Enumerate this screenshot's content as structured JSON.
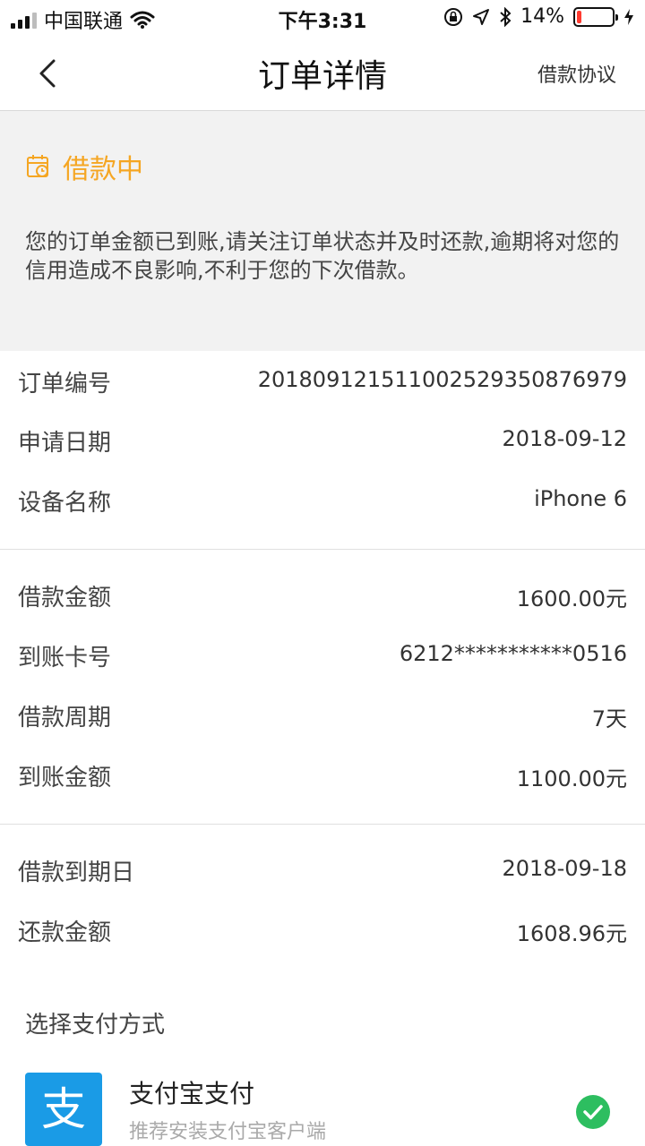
{
  "statusbar": {
    "carrier": "中国联通",
    "time": "下午3:31",
    "battery_text": "14%",
    "battery_level": 0.14,
    "icons": [
      "signal-icon",
      "wifi-icon",
      "rotation-lock-icon",
      "location-icon",
      "bluetooth-icon",
      "battery-icon",
      "charging-icon"
    ]
  },
  "nav": {
    "title": "订单详情",
    "agreement": "借款协议",
    "back_icon": "chevron-left-icon"
  },
  "status": {
    "label": "借款中",
    "message": "您的订单金额已到账,请关注订单状态并及时还款,逾期将对您的信用造成不良影响,不利于您的下次借款。",
    "color": "#f5a623",
    "icon": "clock-calendar-icon"
  },
  "section1": [
    {
      "label": "订单编号",
      "value": "20180912151100252935087697​9"
    },
    {
      "label": "申请日期",
      "value": "2018-09-12"
    },
    {
      "label": "设备名称",
      "value": "iPhone 6"
    }
  ],
  "section2": [
    {
      "label": "借款金额",
      "value": "1600.00元"
    },
    {
      "label": "到账卡号",
      "value": "6212***********0516"
    },
    {
      "label": "借款周期",
      "value": "7天"
    },
    {
      "label": "到账金额",
      "value": "1100.00元"
    }
  ],
  "section3": [
    {
      "label": "借款到期日",
      "value": "2018-09-18"
    },
    {
      "label": "还款金额",
      "value": "1608.96元"
    }
  ],
  "payment": {
    "title": "选择支付方式",
    "method_name": "支付宝支付",
    "method_sub": "推荐安装支付宝客户端",
    "logo_glyph": "支",
    "brand_color": "#1a9be6",
    "selected_color": "#2dbe60"
  }
}
